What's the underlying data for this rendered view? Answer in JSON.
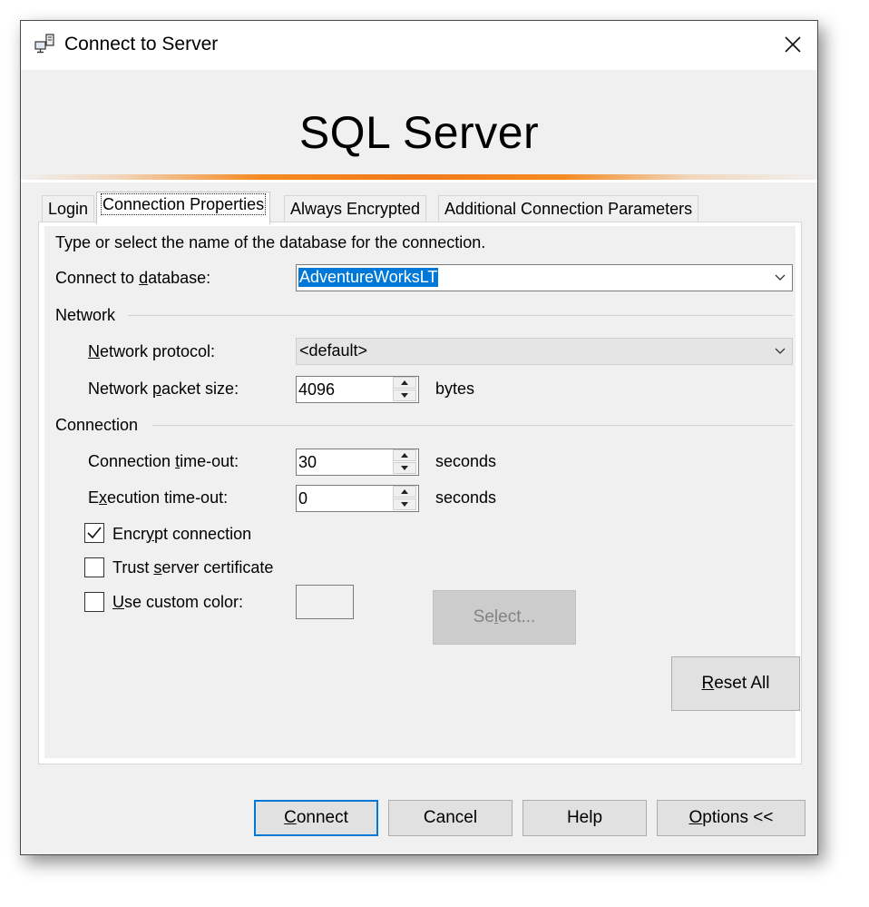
{
  "window": {
    "title": "Connect to Server",
    "banner_title": "SQL Server",
    "accent_color": "#f68a22",
    "icon": "server-connect-icon"
  },
  "tabs": [
    {
      "label": "Login",
      "active": false
    },
    {
      "label": "Connection Properties",
      "active": true
    },
    {
      "label": "Always Encrypted",
      "active": false
    },
    {
      "label": "Additional Connection Parameters",
      "active": false
    }
  ],
  "panel": {
    "intro": "Type or select the name of the database for the connection.",
    "connect_db": {
      "label_pre": "Connect to ",
      "label_acc": "d",
      "label_post": "atabase:",
      "value": "AdventureWorksLT"
    },
    "network": {
      "group_label": "Network",
      "protocol": {
        "label_acc": "N",
        "label_post": "etwork protocol:",
        "value": "<default>"
      },
      "packet": {
        "label_pre": "Network ",
        "label_acc": "p",
        "label_post": "acket size:",
        "value": "4096",
        "unit": "bytes"
      }
    },
    "connection": {
      "group_label": "Connection",
      "conn_timeout": {
        "label_pre": "Connection ",
        "label_acc": "t",
        "label_post": "ime-out:",
        "value": "30",
        "unit": "seconds"
      },
      "exec_timeout": {
        "label_pre": "E",
        "label_acc": "x",
        "label_post": "ecution time-out:",
        "value": "0",
        "unit": "seconds"
      },
      "encrypt": {
        "label_pre": "Encr",
        "label_acc": "y",
        "label_post": "pt connection",
        "checked": true
      },
      "trust": {
        "label_pre": "Trust ",
        "label_acc": "s",
        "label_post": "erver certificate",
        "checked": false
      },
      "custom_color": {
        "label_pre": "",
        "label_acc": "U",
        "label_post": "se custom color:",
        "checked": false
      },
      "select_button": {
        "pre": "Se",
        "acc": "l",
        "post": "ect..."
      }
    },
    "reset_button": {
      "acc": "R",
      "post": "eset All"
    }
  },
  "footer": {
    "connect": {
      "acc": "C",
      "post": "onnect"
    },
    "cancel": "Cancel",
    "help": "Help",
    "options": {
      "acc": "O",
      "post": "ptions <<"
    }
  }
}
